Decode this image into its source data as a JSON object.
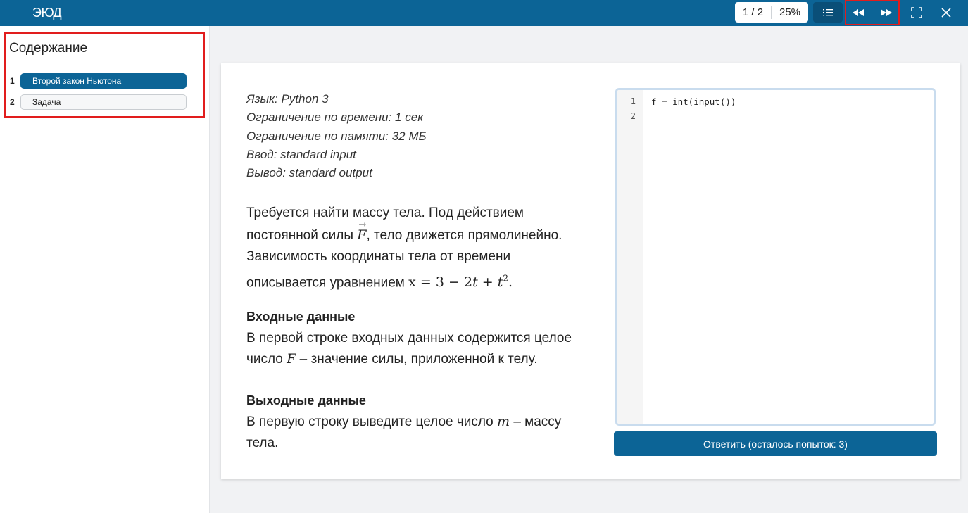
{
  "header": {
    "logo_text": "ЭЮД",
    "page_indicator": "1 / 2",
    "zoom": "25%",
    "icons": [
      "list-icon",
      "rewind-icon",
      "fast-forward-icon",
      "fullscreen-icon",
      "close-icon"
    ]
  },
  "sidebar": {
    "title": "Содержание",
    "items": [
      {
        "num": "1",
        "label": "Второй закон Ньютона"
      },
      {
        "num": "2",
        "label": "Задача"
      }
    ]
  },
  "task": {
    "meta": [
      "Язык: Python 3",
      "Ограничение по времени: 1 сек",
      "Ограничение по памяти: 32 МБ",
      "Ввод: standard input",
      "Вывод: standard output"
    ],
    "statement": {
      "p1": "Требуется найти массу тела. Под действием",
      "p2a": "постоянной силы ",
      "force": "F",
      "p2b": ", тело движется прямолинейно.",
      "p3": "Зависимость координаты тела от времени",
      "p4a": "описывается уравнением ",
      "eq_x": "x",
      "eq_body": " = 3 − 2",
      "eq_t": "t",
      "eq_plus": " + ",
      "eq_t2": "t",
      "eq_exp": "2",
      "eq_end": "."
    },
    "input_section": {
      "heading": "Входные данные",
      "l1": "В первой строке входных данных содержится целое",
      "l2a": "число ",
      "var": "F",
      "l2b": " – значение силы, приложенной к телу."
    },
    "output_section": {
      "heading": "Выходные данные",
      "l1a": "В первую строку выведите целое число ",
      "var": "m",
      "l1b": " – массу",
      "l2": "тела."
    }
  },
  "editor": {
    "lines": [
      "f = int(input())",
      ""
    ],
    "line_numbers": [
      "1",
      "2"
    ],
    "submit_label": "Ответить (осталось попыток: 3)"
  }
}
